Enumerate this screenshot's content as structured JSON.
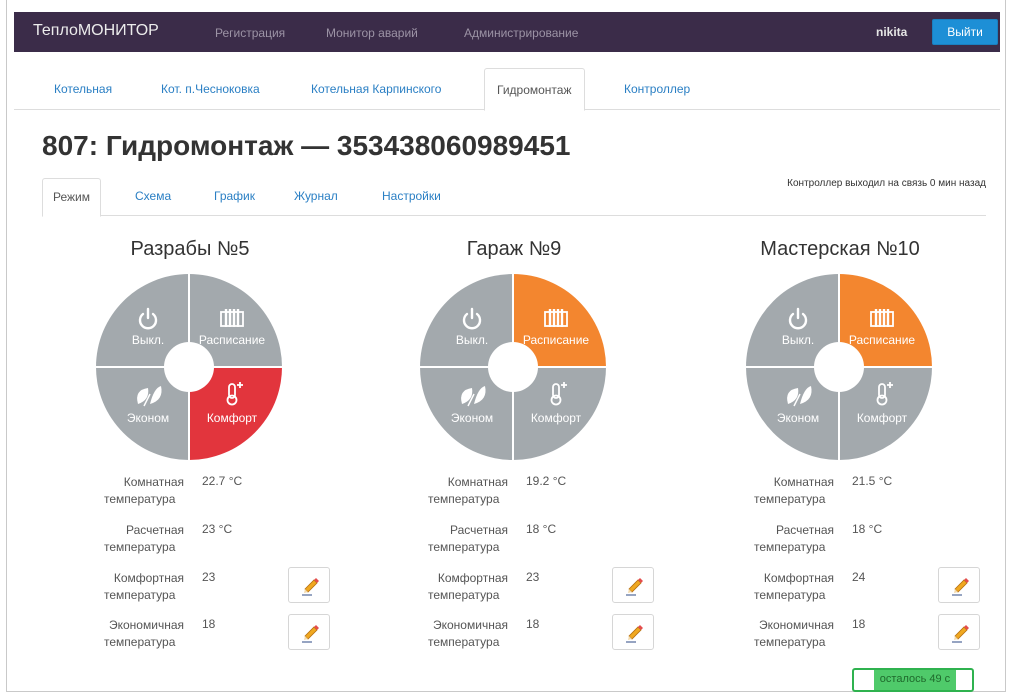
{
  "navbar": {
    "brand": "ТеплоМОНИТОР",
    "links": [
      "Регистрация",
      "Монитор аварий",
      "Администрирование"
    ],
    "user": "nikita",
    "logout_label": "Выйти"
  },
  "boiler_tabs": [
    "Котельная",
    "Кот. п.Чесноковка",
    "Котельная Карпинского",
    "Гидромонтаж",
    "Контроллер"
  ],
  "boiler_tabs_active": 3,
  "page_title": "807: Гидромонтаж — 353438060989451",
  "view_tabs": [
    "Режим",
    "Схема",
    "График",
    "Журнал",
    "Настройки"
  ],
  "view_tabs_active": 0,
  "last_seen": "Контроллер выходил на связь 0 мин назад",
  "mode_labels": {
    "off": "Выкл.",
    "schedule": "Расписание",
    "economy": "Эконом",
    "comfort": "Комфорт"
  },
  "colors": {
    "inactive": "#a3a9ad",
    "active_red": "#e2353d",
    "active_orange": "#f3862f",
    "navbar": "#3b2c49",
    "accent": "#1d8fd6"
  },
  "param_labels": {
    "room": [
      "Комнатная",
      "температура"
    ],
    "calc": [
      "Расчетная",
      "температура"
    ],
    "comfort": [
      "Комфортная",
      "температура"
    ],
    "economy": [
      "Экономичная",
      "температура"
    ]
  },
  "zones": [
    {
      "name": "Разрабы №5",
      "active_mode": "comfort",
      "active_color": "#e2353d",
      "room_temp": "22.7 °C",
      "calc_temp": "23 °C",
      "comfort_temp": "23",
      "economy_temp": "18"
    },
    {
      "name": "Гараж №9",
      "active_mode": "schedule",
      "active_color": "#f3862f",
      "room_temp": "19.2 °C",
      "calc_temp": "18 °C",
      "comfort_temp": "23",
      "economy_temp": "18"
    },
    {
      "name": "Мастерская №10",
      "active_mode": "schedule",
      "active_color": "#f3862f",
      "room_temp": "21.5 °C",
      "calc_temp": "18 °C",
      "comfort_temp": "24",
      "economy_temp": "18"
    }
  ],
  "timer": {
    "text": "осталось 49 с",
    "progress": 0.83
  }
}
